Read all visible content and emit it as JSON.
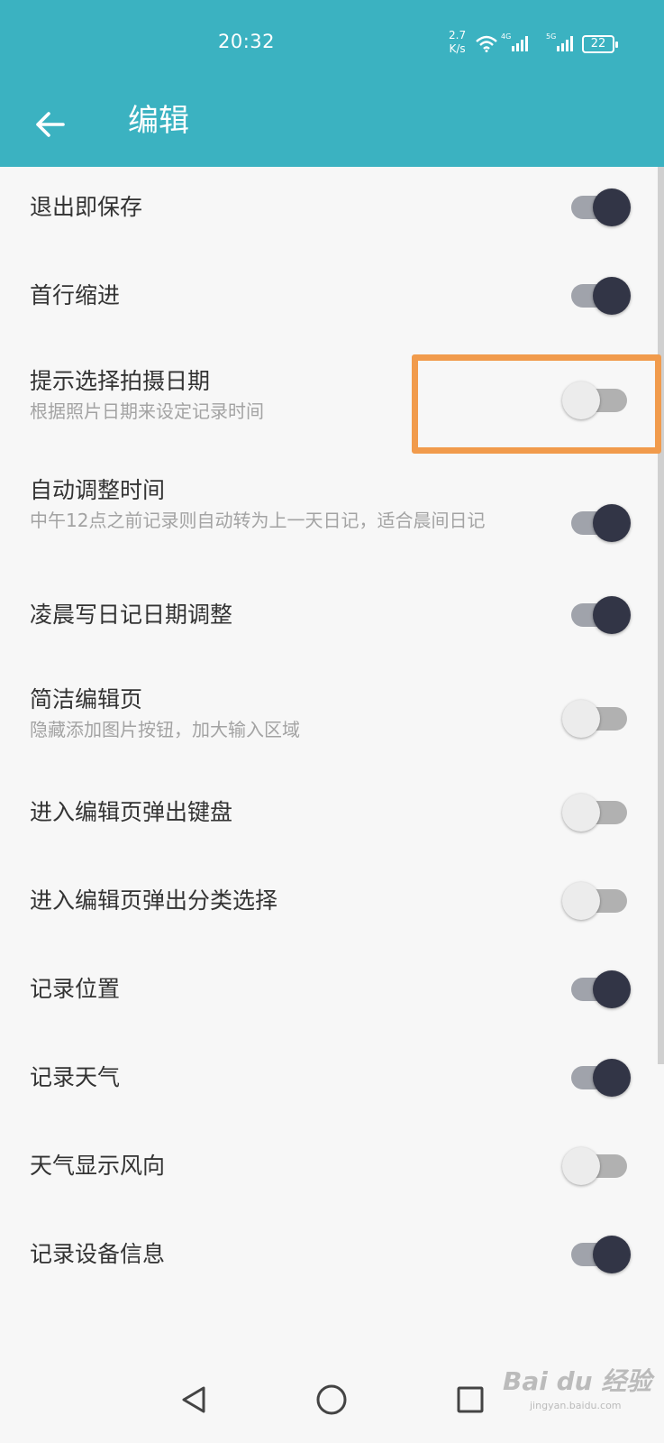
{
  "status_bar": {
    "time": "20:32",
    "net_speed_value": "2.7",
    "net_speed_unit": "K/s",
    "signal1_label": "4G",
    "signal2_label": "5G",
    "battery": "22"
  },
  "toolbar": {
    "back_icon": "arrow-left-icon",
    "title": "编辑"
  },
  "settings": [
    {
      "title": "退出即保存",
      "subtitle": "",
      "enabled": true
    },
    {
      "title": "首行缩进",
      "subtitle": "",
      "enabled": true
    },
    {
      "title": "提示选择拍摄日期",
      "subtitle": "根据照片日期来设定记录时间",
      "enabled": false
    },
    {
      "title": "自动调整时间",
      "subtitle": "中午12点之前记录则自动转为上一天日记，适合晨间日记",
      "enabled": true
    },
    {
      "title": "凌晨写日记日期调整",
      "subtitle": "",
      "enabled": true
    },
    {
      "title": "简洁编辑页",
      "subtitle": "隐藏添加图片按钮，加大输入区域",
      "enabled": false
    },
    {
      "title": "进入编辑页弹出键盘",
      "subtitle": "",
      "enabled": false
    },
    {
      "title": "进入编辑页弹出分类选择",
      "subtitle": "",
      "enabled": false
    },
    {
      "title": "记录位置",
      "subtitle": "",
      "enabled": true
    },
    {
      "title": "记录天气",
      "subtitle": "",
      "enabled": true
    },
    {
      "title": "天气显示风向",
      "subtitle": "",
      "enabled": false
    },
    {
      "title": "记录设备信息",
      "subtitle": "",
      "enabled": true
    }
  ],
  "nav_bar": {
    "back_icon": "triangle-back-icon",
    "home_icon": "circle-home-icon",
    "recents_icon": "square-recents-icon"
  },
  "watermark": {
    "text": "Bai du 经验",
    "sub": "jingyan.baidu.com"
  },
  "colors": {
    "header": "#3bb2c1",
    "highlight": "#f19b4c",
    "switch_on_thumb": "#323546"
  }
}
